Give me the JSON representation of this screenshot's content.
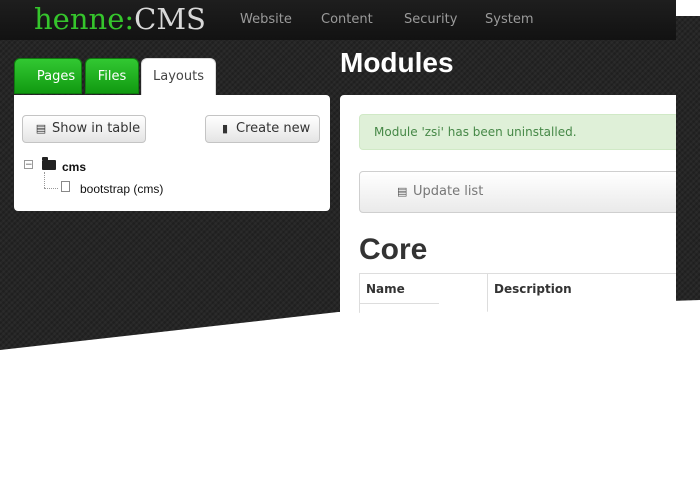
{
  "header": {
    "logo_green": "henne:",
    "logo_grey": "CMS",
    "nav": [
      "Website",
      "Content",
      "Security",
      "System"
    ]
  },
  "tabs": [
    {
      "label": "Pages",
      "state": "green"
    },
    {
      "label": "Files",
      "state": "green"
    },
    {
      "label": "Layouts",
      "state": "active"
    }
  ],
  "sidebar": {
    "show_in_table_label": "Show in table",
    "create_new_label": "Create new",
    "tree": {
      "folder_label": "cms",
      "items": [
        "bootstrap (cms)"
      ]
    }
  },
  "main": {
    "page_title": "Modules",
    "alert_text": "Module 'zsi' has been uninstalled.",
    "update_list_label": "Update list",
    "section_title": "Core",
    "table": {
      "columns": [
        "Name",
        "Description"
      ]
    }
  },
  "colors": {
    "brand_green": "#35c52c",
    "tab_green": "#1fae1f",
    "alert_bg": "#dff0d8",
    "alert_text": "#468847",
    "background_dark": "#262626"
  },
  "icons": {
    "table": "list-icon",
    "create": "file-icon",
    "folder": "folder-icon",
    "file": "file-outline-icon",
    "update": "list-icon"
  }
}
